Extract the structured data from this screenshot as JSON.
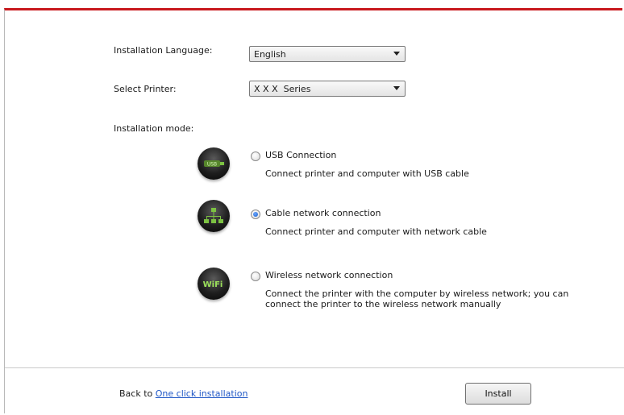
{
  "form": {
    "language_label": "Installation Language:",
    "language_value": "English",
    "printer_label": "Select Printer:",
    "printer_value": "X X X  Series",
    "mode_label": "Installation mode:"
  },
  "modes": [
    {
      "icon": "usb-icon",
      "title": "USB Connection",
      "desc": "Connect printer and computer with USB cable",
      "selected": false
    },
    {
      "icon": "network-icon",
      "title": "Cable network connection",
      "desc": "Connect printer and computer with network cable",
      "selected": true
    },
    {
      "icon": "wifi-icon",
      "title": "Wireless network connection",
      "desc": "Connect the printer with the computer by wireless network; you can connect the printer to the wireless network manually",
      "selected": false
    }
  ],
  "icon_text": {
    "usb": "USB",
    "wifi": "WiFi"
  },
  "footer": {
    "back_prefix": "Back to",
    "back_link": "One click installation",
    "install_label": "Install"
  },
  "colors": {
    "accent_bar": "#c8191e",
    "link": "#1f57c6",
    "icon_green": "#7cc242"
  }
}
